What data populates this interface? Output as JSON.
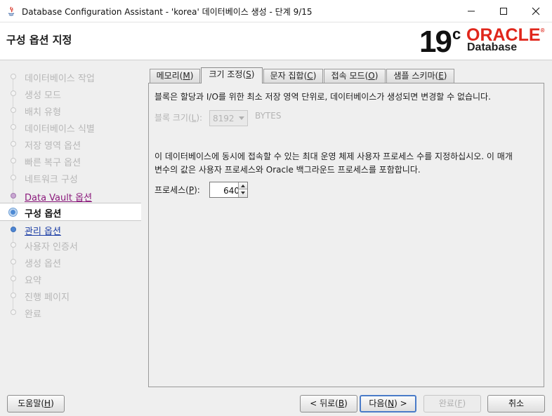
{
  "window": {
    "title": "Database Configuration Assistant - 'korea' 데이터베이스 생성 - 단계 9/15",
    "minimize_icon": "minimize-icon",
    "maximize_icon": "maximize-icon",
    "close_icon": "close-icon"
  },
  "header": {
    "step_title": "구성 옵션 지정",
    "logo": {
      "version": "19",
      "version_suffix": "c",
      "brand": "ORACLE",
      "registered": "®",
      "product": "Database"
    }
  },
  "steps": [
    {
      "label": "데이터베이스 작업",
      "state": "disabled"
    },
    {
      "label": "생성 모드",
      "state": "disabled"
    },
    {
      "label": "배치 유형",
      "state": "disabled"
    },
    {
      "label": "데이터베이스 식별",
      "state": "disabled"
    },
    {
      "label": "저장 영역 옵션",
      "state": "disabled"
    },
    {
      "label": "빠른 복구 옵션",
      "state": "disabled"
    },
    {
      "label": "네트워크 구성",
      "state": "disabled"
    },
    {
      "label": "Data Vault 옵션",
      "state": "visited"
    },
    {
      "label": "구성 옵션",
      "state": "current"
    },
    {
      "label": "관리 옵션",
      "state": "next"
    },
    {
      "label": "사용자 인증서",
      "state": "disabled"
    },
    {
      "label": "생성 옵션",
      "state": "disabled"
    },
    {
      "label": "요약",
      "state": "disabled"
    },
    {
      "label": "진행 페이지",
      "state": "disabled"
    },
    {
      "label": "완료",
      "state": "disabled"
    }
  ],
  "tabs": [
    {
      "label": "메모리(",
      "mnemonic": "M",
      "suffix": ")",
      "active": false
    },
    {
      "label": "크기 조정(",
      "mnemonic": "S",
      "suffix": ")",
      "active": true
    },
    {
      "label": "문자 집합(",
      "mnemonic": "C",
      "suffix": ")",
      "active": false
    },
    {
      "label": "접속 모드(",
      "mnemonic": "O",
      "suffix": ")",
      "active": false
    },
    {
      "label": "샘플 스키마(",
      "mnemonic": "E",
      "suffix": ")",
      "active": false
    }
  ],
  "sizing": {
    "block_info": "블록은 할당과 I/O를 위한 최소 저장 영역 단위로, 데이터베이스가 생성되면 변경할 수 없습니다.",
    "block_size_label_prefix": "블록 크기(",
    "block_size_mnemonic": "L",
    "block_size_label_suffix": "):",
    "block_size_value": "8192",
    "block_size_unit": "BYTES",
    "process_info_line1": "이 데이터베이스에 동시에 접속할 수 있는 최대 운영 체제 사용자 프로세스 수를 지정하십시오. 이 매개",
    "process_info_line2": "변수의 값은 사용자 프로세스와 Oracle 백그라운드 프로세스를 포함합니다.",
    "processes_label_prefix": "프로세스(",
    "processes_mnemonic": "P",
    "processes_label_suffix": "):",
    "processes_value": "640"
  },
  "buttons": {
    "help": {
      "prefix": "도움말(",
      "mnemonic": "H",
      "suffix": ")"
    },
    "back": {
      "prefix": "< 뒤로(",
      "mnemonic": "B",
      "suffix": ")"
    },
    "next": {
      "prefix": "다음(",
      "mnemonic": "N",
      "suffix": ") >"
    },
    "finish": {
      "prefix": "완료(",
      "mnemonic": "F",
      "suffix": ")"
    },
    "cancel": {
      "label": "취소"
    }
  }
}
